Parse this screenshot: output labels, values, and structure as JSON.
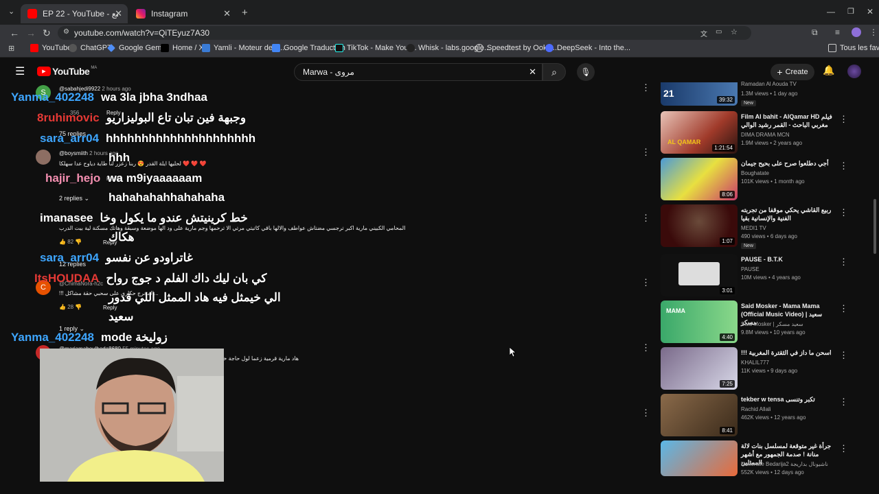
{
  "browser": {
    "tabs": [
      {
        "title": "EP 22 - YouTube - عش الطمع",
        "active": true
      },
      {
        "title": "Instagram",
        "active": false
      }
    ],
    "url": "youtube.com/watch?v=QiTEyuz7A30",
    "bookmarks": [
      "YouTube",
      "ChatGPT",
      "Google Gemini",
      "Home / X",
      "Yamli - Moteur de R...",
      "Google Traduction",
      "TikTok - Make Your...",
      "Whisk - labs.google...",
      "Speedtest by Ookla...",
      "DeepSeek - Into the..."
    ],
    "all_bookmarks": "Tous les favoris"
  },
  "youtube": {
    "logo": "YouTube",
    "region": "MA",
    "search_value": "Marwa - مروى",
    "create_label": "Create"
  },
  "comments": [
    {
      "author": "@sabahjedi9922",
      "time": "2 hours ago",
      "likes": "356",
      "reply": "Reply",
      "replies": "75 replies"
    },
    {
      "author": "@boysmiith",
      "time": "2 hours ago",
      "text": "لحليها ايلة القدر 😍 ربنا زعزر لنا طاية دياوح عدا سهلكا ❤️ ❤️ ❤️",
      "reply": "Reply",
      "replies": "2 replies"
    },
    {
      "author": "@",
      "text": "المحامي الكبيني مارية اكبر ترجسي مضتاش عواطف والالها باقي كاتيتي مرتي الا ترحمها وجم مارية على ود الها موضعة وسبقة وهاتك مسكنة لية بيت الدرب",
      "likes": "82",
      "reply": "Reply",
      "replies": "12 replies"
    },
    {
      "author": "@ChimaNora-h2c",
      "text": "!!! المخرج حكاري على سحبي حقة مشاكل...",
      "likes": "28",
      "reply": "Reply",
      "replies": "1 reply"
    },
    {
      "author": "@mariamaboulhoda8680",
      "time": "55 minutes ago",
      "text": "هاد مارية قرمية زعما لول حاجة خاصها تفكر فيه"
    }
  ],
  "chat_overlay": [
    {
      "user": "Yanma_402248",
      "color": "#3ea6ff",
      "text": "wa 3la jbha 3ndhaa"
    },
    {
      "user": "8ruhimovic",
      "color": "#e53935",
      "text": "وجبهة فين تبان تاع البوليزاريو"
    },
    {
      "user": "sara_arr04",
      "color": "#3ea6ff",
      "text": "hhhhhhhhhhhhhhhhhhhhh"
    },
    {
      "user": "",
      "color": "#ffffff",
      "text": "hhh"
    },
    {
      "user": "hajir_hejo",
      "color": "#f48fb1",
      "text": "wa m9iyaaaaaam"
    },
    {
      "user": "",
      "color": "#ffffff",
      "text": "hahahahahhahahaha"
    },
    {
      "user": "imanasee",
      "color": "#ffffff",
      "text": "خط كرينيتش عندو ما يكول وخا"
    },
    {
      "user": "",
      "color": "#ffffff",
      "text": "هكاك"
    },
    {
      "user": "sara_arr04",
      "color": "#3ea6ff",
      "text": "غاتراودو عن نفسو"
    },
    {
      "user": "ItsHOUDAA",
      "color": "#e53935",
      "text": "كي بان ليك داك الفلم د جوج رواح"
    },
    {
      "user": "",
      "color": "#ffffff",
      "text": "الي خيمثل فيه هاد الممثل اللي قدور"
    },
    {
      "user": "",
      "color": "#ffffff",
      "text": "سعيد"
    },
    {
      "user": "Yanma_402248",
      "color": "#3ea6ff",
      "text": "mode زوليخة"
    }
  ],
  "related": [
    {
      "title": "",
      "channel": "Ramadan Al Aouda TV",
      "meta": "1.3M views • 1 day ago",
      "badge": "New",
      "duration": "39:32"
    },
    {
      "title": "Film Al bahit - AlQamar HD فيلم مغربي الباحث - القمر رشيد الوالي",
      "channel": "DIMA DRAMA MCN",
      "meta": "1.9M views • 2 years ago",
      "duration": "1:21:54"
    },
    {
      "title": "أجي دطلعوا صرح على بحيح جيمان",
      "channel": "Boughatate",
      "meta": "101K views • 1 month ago",
      "duration": "8:06"
    },
    {
      "title": "ربيع القاشي يحكي موقفا من تجربته الفنية والإنسانية بقيا",
      "channel": "MEDI1 TV",
      "meta": "490 views • 6 days ago",
      "badge": "New",
      "duration": "1:07"
    },
    {
      "title": "PAUSE - B.T.K",
      "channel": "PAUSE",
      "meta": "10M views • 4 years ago",
      "duration": "3:01"
    },
    {
      "title": "Said Mosker - Mama Mama (Official Music Video) | سعيد مسكر",
      "channel": "Said Mosker | سعيد مسكر",
      "meta": "9.8M views • 10 years ago",
      "duration": "4:40"
    },
    {
      "title": "!!! اسحن ما داز في الثقترة المغربية",
      "channel": "KHALIL777",
      "meta": "11K views • 9 days ago",
      "duration": "7:25"
    },
    {
      "title": "tekber w tensa تكبر وتنسى",
      "channel": "Rachid Allali",
      "meta": "462K views • 12 years ago",
      "duration": "8:41"
    },
    {
      "title": "جرأة غير متوقعة لمسلسل بنات لالة منانة ! صدمة الجمهور مع أشهر الممثلين",
      "channel": "Nationale Bedarija2 ناشيونال بداريجة",
      "meta": "552K views • 12 days ago",
      "duration": ""
    }
  ]
}
